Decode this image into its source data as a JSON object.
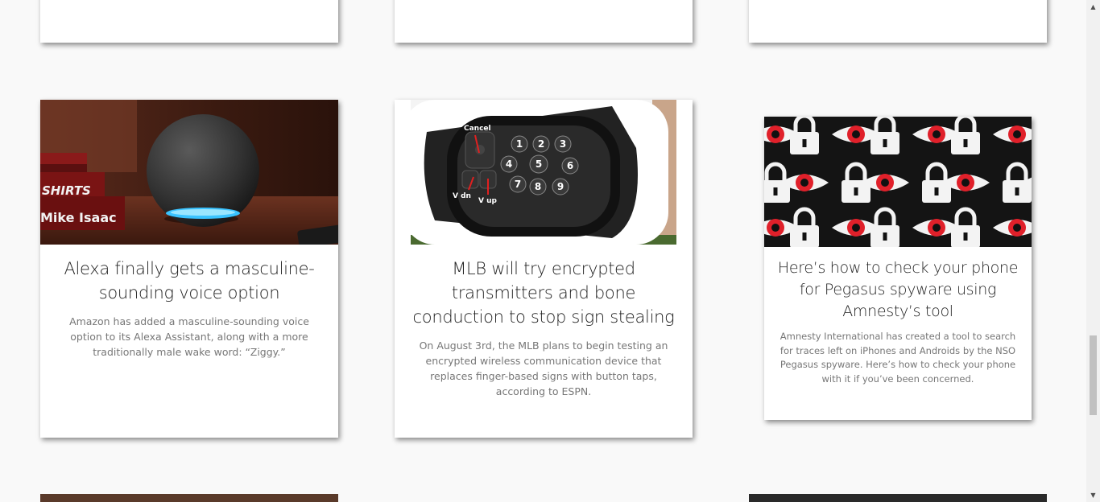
{
  "cards": [
    {
      "title": "Alexa finally gets a masculine-sounding voice option",
      "description": "Amazon has added a masculine-sounding voice option to its Alexa Assistant, along with a more traditionally male wake word: “Ziggy.”",
      "image": "echo-dot-speaker-image",
      "book_spine_1": "SHIRTS",
      "book_spine_2": "Mike Isaac"
    },
    {
      "title": "MLB will try encrypted transmitters and bone conduction to stop sign stealing",
      "description": "On August 3rd, the MLB plans to begin testing an encrypted wireless communication device that replaces finger-based signs with button taps, according to ESPN.",
      "image": "pitchcom-wristband-image",
      "keypad": {
        "cancel": "Cancel",
        "vdn": "V dn",
        "vup": "V up",
        "keys": [
          "1",
          "2",
          "3",
          "4",
          "5",
          "6",
          "7",
          "8",
          "9"
        ]
      }
    },
    {
      "title": "Here’s how to check your phone for Pegasus spyware using Amnesty’s tool",
      "description": "Amnesty International has created a tool to search for traces left on iPhones and Androids by the NSO Pegasus spyware. Here’s how to check your phone with it if you’ve been concerned.",
      "image": "eyes-and-locks-pattern-image"
    }
  ],
  "colors": {
    "page_bg": "#f9f9f9",
    "card_bg": "#ffffff",
    "title": "#222222",
    "description": "#777777",
    "echo_ring": "#3ac3ff",
    "eye_red": "#e0202a"
  }
}
